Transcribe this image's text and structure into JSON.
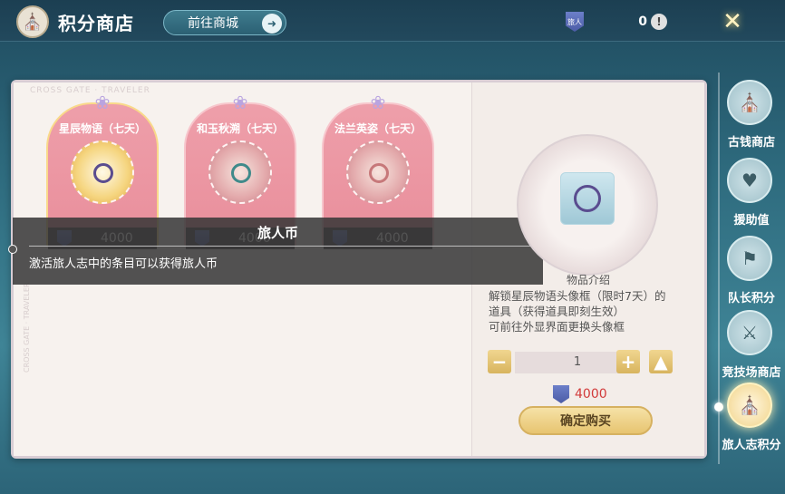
{
  "header": {
    "title": "积分商店",
    "goto_mall_label": "前往商城",
    "currency_amount": "0",
    "badge_text": "旅人"
  },
  "book": {
    "watermark": "CROSS GATE · TRAVELER",
    "watermark_vertical": "CROSS GATE · TRAVELER"
  },
  "items": [
    {
      "name": "星辰物语（七天）",
      "price": "4000",
      "selected": true
    },
    {
      "name": "和玉秋溯（七天）",
      "price": "4000",
      "selected": false
    },
    {
      "name": "法兰英姿（七天）",
      "price": "4000",
      "selected": false
    }
  ],
  "tooltip": {
    "title": "旅人币",
    "description": "激活旅人志中的条目可以获得旅人币"
  },
  "detail": {
    "header": "物品介绍",
    "description_line1": "解锁星辰物语头像框（限时7天）的",
    "description_line2": "道具（获得道具即刻生效）",
    "description_line3": "可前往外显界面更换头像框",
    "quantity": "1",
    "price": "4000",
    "buy_label": "确定购买"
  },
  "sidenav": [
    {
      "label": "古钱商店",
      "icon": "shop-icon",
      "active": false
    },
    {
      "label": "援助值",
      "icon": "handshake-icon",
      "active": false
    },
    {
      "label": "队长积分",
      "icon": "flag-icon",
      "active": false
    },
    {
      "label": "竞技场商店",
      "icon": "arena-shop-icon",
      "active": false
    },
    {
      "label": "旅人志积分",
      "icon": "traveler-shop-icon",
      "active": true
    }
  ],
  "colors": {
    "accent_gold": "#e7c470",
    "card_pink": "#e98e9b",
    "price_red": "#d23a3a"
  }
}
